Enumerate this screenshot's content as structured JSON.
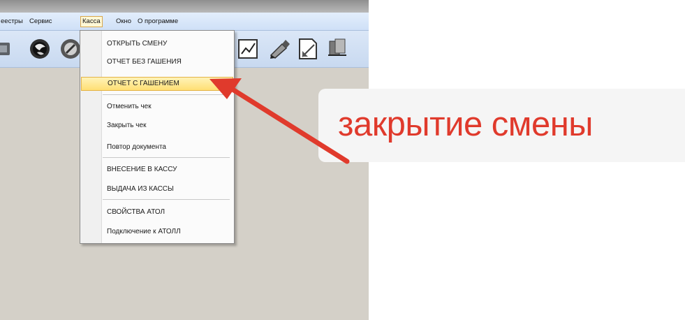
{
  "menubar": {
    "items": [
      "еестры",
      "Сервис",
      "Касса",
      "Окно",
      "О программе"
    ],
    "active_index": 2
  },
  "toolbar": {
    "icons": [
      "record-icon",
      "globe-icon",
      "settings-icon",
      "chart-icon",
      "pen-icon",
      "document-icon",
      "stamp-icon"
    ]
  },
  "kassa_menu": {
    "items": [
      "ОТКРЫТЬ СМЕНУ",
      "ОТЧЕТ БЕЗ ГАШЕНИЯ",
      "ОТЧЕТ С ГАШЕНИЕМ",
      "Отменить чек",
      "Закрыть чек",
      "Повтор документа",
      "ВНЕСЕНИЕ В КАССУ",
      "ВЫДАЧА ИЗ КАССЫ",
      "СВОЙСТВА АТОЛ",
      "Подключение к АТОЛЛ"
    ],
    "highlighted_index": 2
  },
  "annotation": {
    "text": "закрытие смены",
    "color": "#e03a2c"
  }
}
